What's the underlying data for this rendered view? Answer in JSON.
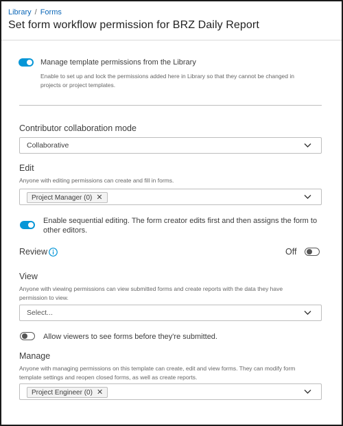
{
  "breadcrumb": {
    "library": "Library",
    "separator": "/",
    "forms": "Forms"
  },
  "page_title": "Set form workflow permission for BRZ Daily Report",
  "manage_template": {
    "label": "Manage template permissions from the Library",
    "help_line1": "Enable to set up and lock the permissions added here in Library so that they cannot be changed in",
    "help_line2": "projects or project templates.",
    "enabled": true
  },
  "collaboration": {
    "label": "Contributor collaboration mode",
    "value": "Collaborative"
  },
  "edit": {
    "label": "Edit",
    "help": "Anyone with editing permissions can create and fill in forms.",
    "chips": [
      "Project Manager (0)"
    ]
  },
  "sequential": {
    "label_line1": "Enable sequential editing. The form creator edits first and then assigns the form to",
    "label_line2": "other editors.",
    "enabled": true
  },
  "review": {
    "label": "Review",
    "state": "Off",
    "enabled": false
  },
  "view": {
    "label": "View",
    "help_line1": "Anyone with viewing permissions can view submitted forms and create reports with the data they have",
    "help_line2": "permission to view.",
    "placeholder": "Select..."
  },
  "allow_viewers": {
    "label": "Allow viewers to see forms before they're submitted.",
    "enabled": false
  },
  "manage": {
    "label": "Manage",
    "help_line1": "Anyone with managing permissions on this template can create, edit and view forms. They can modify form",
    "help_line2": "template settings and reopen closed forms, as well as create reports.",
    "chips": [
      "Project Engineer (0)"
    ]
  },
  "colors": {
    "accent": "#0696d7",
    "link": "#0a66b7"
  },
  "icons": {
    "chevron": "chevron-down-icon",
    "remove": "close-icon",
    "info": "info-icon"
  }
}
